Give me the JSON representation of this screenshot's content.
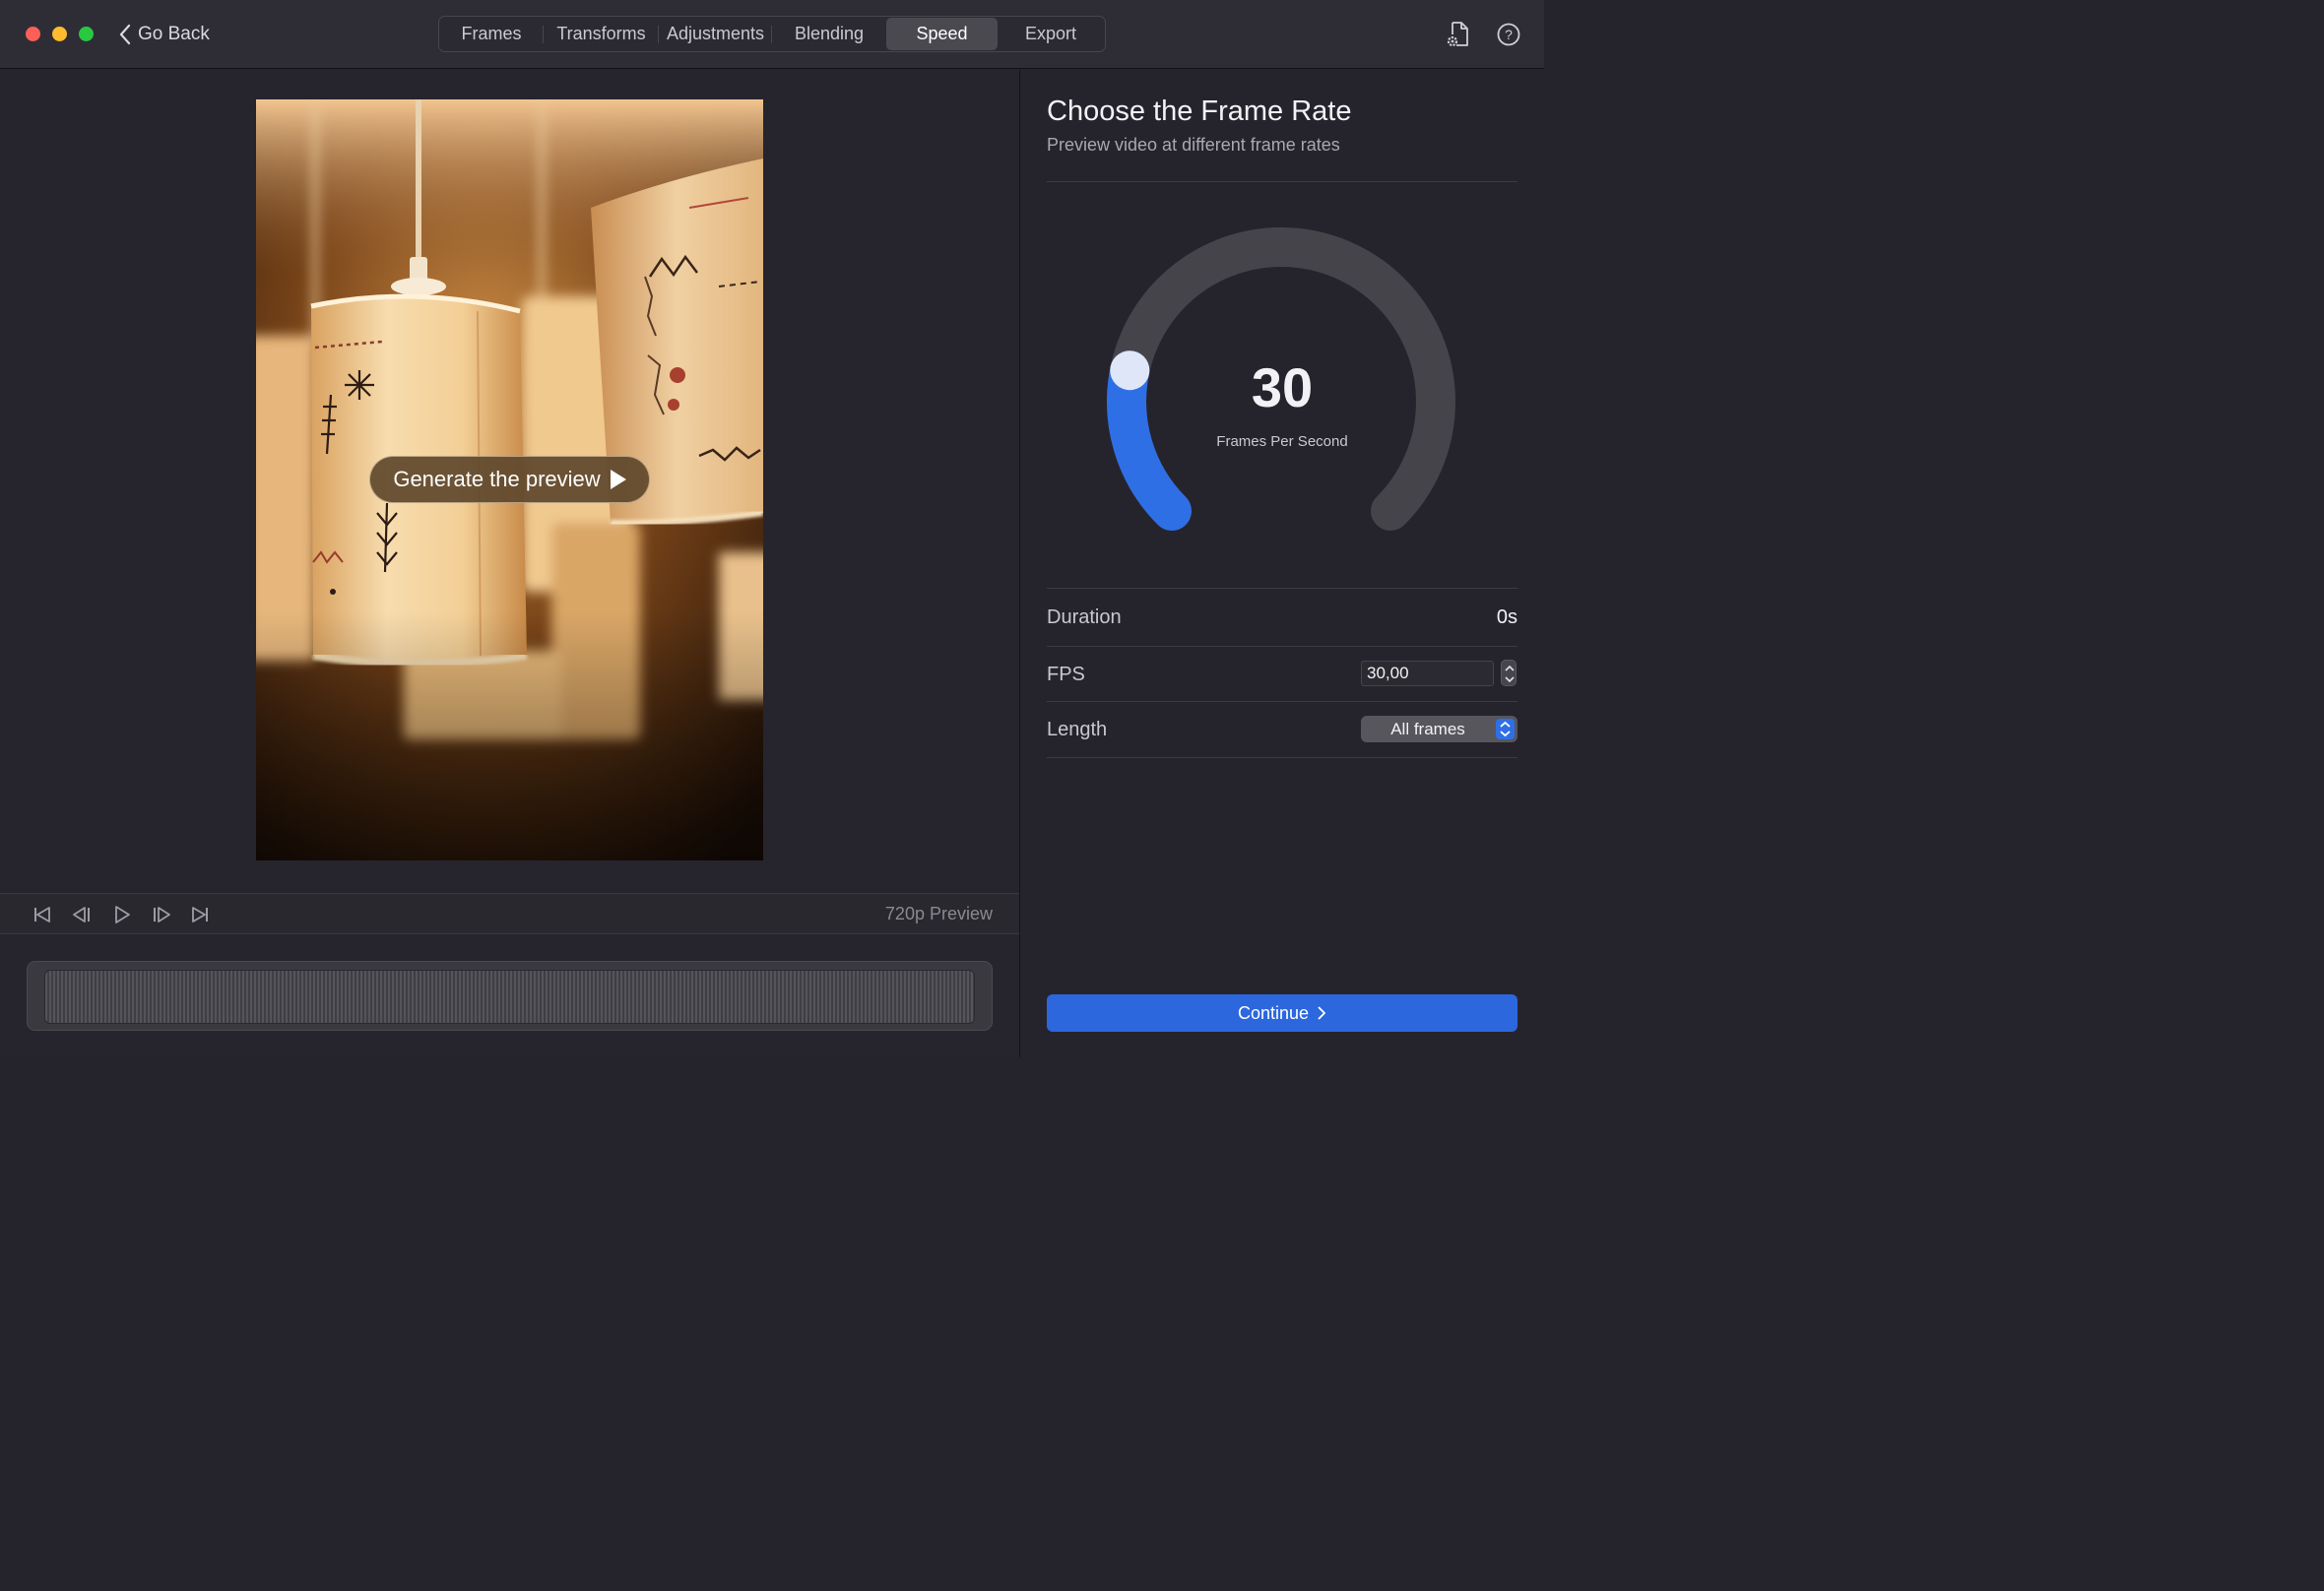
{
  "titlebar": {
    "go_back_label": "Go Back",
    "tabs": [
      {
        "label": "Frames"
      },
      {
        "label": "Transforms"
      },
      {
        "label": "Adjustments"
      },
      {
        "label": "Blending"
      },
      {
        "label": "Speed",
        "active": true
      },
      {
        "label": "Export"
      }
    ],
    "icons": [
      "document-settings-icon",
      "help-icon"
    ]
  },
  "preview": {
    "generate_button_label": "Generate the preview",
    "quality_label": "720p Preview",
    "image_description_alt": "Photo of hanging fabric lanterns"
  },
  "playback_controls": [
    "skip-to-start-icon",
    "step-backward-icon",
    "play-icon",
    "step-forward-icon",
    "skip-to-end-icon"
  ],
  "panel": {
    "title": "Choose the Frame Rate",
    "subtitle": "Preview video at different frame rates",
    "gauge": {
      "value": "30",
      "label": "Frames Per Second",
      "fill_fraction": 0.21,
      "accent_color": "#2f6fe6"
    },
    "duration": {
      "label": "Duration",
      "value": "0s"
    },
    "fps": {
      "label": "FPS",
      "value": "30,00"
    },
    "length": {
      "label": "Length",
      "value": "All frames"
    },
    "continue_label": "Continue"
  }
}
